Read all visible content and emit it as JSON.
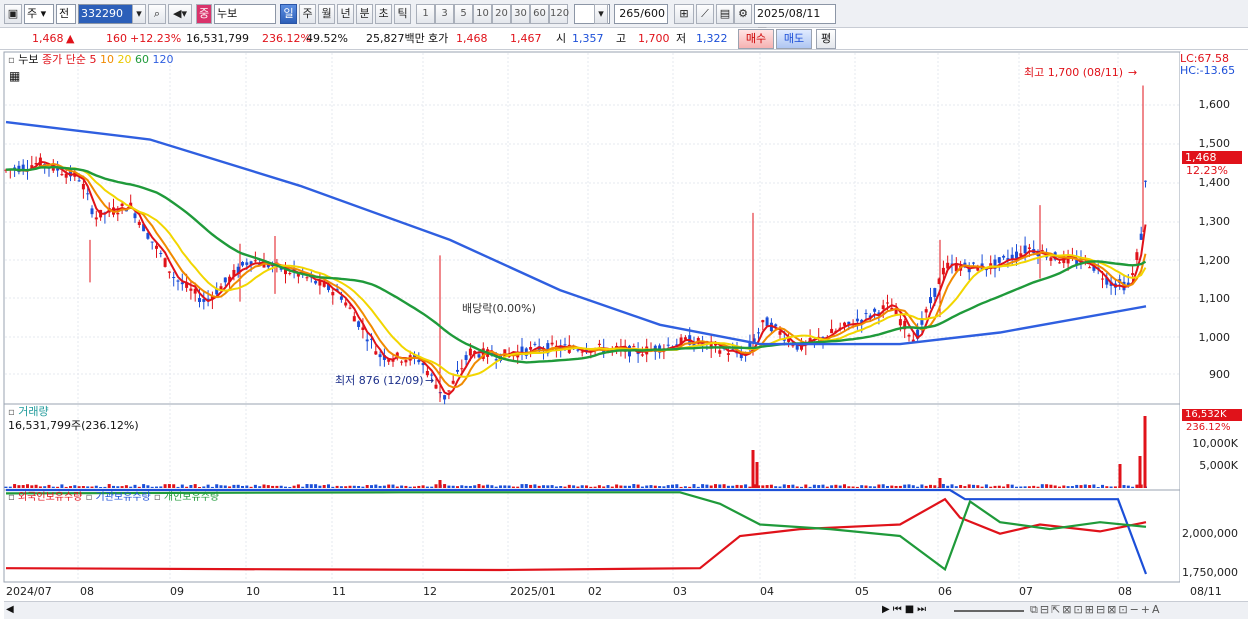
{
  "toolbar": {
    "market": "주",
    "market2": "전",
    "code": "332290",
    "name": "누보",
    "periods": [
      "일",
      "주",
      "월",
      "년",
      "분",
      "초",
      "틱"
    ],
    "active_period": "일",
    "numbers": [
      "1",
      "3",
      "5",
      "10",
      "20",
      "30",
      "60",
      "120"
    ],
    "count": "265",
    "count_max": "/600",
    "date": "2025/08/11"
  },
  "quote": {
    "price": "1,468",
    "arrow": "▲",
    "change": "160",
    "change_pct": "+12.23%",
    "volume": "16,531,799",
    "vol_pct": "236.12%",
    "turnover_pct": "49.52%",
    "amount": "25,827백만",
    "hoga_label": "호가",
    "ask": "1,468",
    "bid": "1,467",
    "open_label": "시",
    "open": "1,357",
    "high_label": "고",
    "high": "1,700",
    "low_label": "저",
    "low": "1,322",
    "buy_label": "매수",
    "sell_label": "매도",
    "eval_label": "평"
  },
  "price_panel": {
    "name": "누보",
    "ma_prefix": "종가 단순",
    "ma_labels": [
      "5",
      "10",
      "20",
      "60",
      "120"
    ],
    "lc": "LC:67.58",
    "hc": "HC:-13.65",
    "high_note": "최고 1,700 (08/11)",
    "low_note": "최저 876 (12/09)",
    "dividend_note": "배당락(0.00%)",
    "current": "1,468",
    "current_pct": "12.23%",
    "y_ticks": [
      "1,600",
      "1,500",
      "1,400",
      "1,300",
      "1,200",
      "1,100",
      "1,000",
      "900"
    ]
  },
  "volume_panel": {
    "title": "거래량",
    "value": "16,531,799주(236.12%)",
    "badge": "16,532K",
    "badge_pct": "236.12%",
    "y_ticks": [
      "10,000K",
      "5,000K"
    ]
  },
  "holding_panel": {
    "legend": [
      "외국인보유수량",
      "기관보유수량",
      "개인보유수량"
    ],
    "y_ticks": [
      "2,000,000",
      "1,750,000"
    ]
  },
  "x_ticks": [
    "2024/07",
    "08",
    "09",
    "10",
    "11",
    "12",
    "2025/01",
    "02",
    "03",
    "04",
    "05",
    "06",
    "07",
    "08"
  ],
  "x_last": "08/11",
  "colors": {
    "up": "#e0121a",
    "down": "#1c4fd8",
    "ma5": "#e0121a",
    "ma10": "#f08a00",
    "ma20": "#f2d600",
    "ma60": "#1f9a3a",
    "ma120": "#2f5fe0"
  }
}
